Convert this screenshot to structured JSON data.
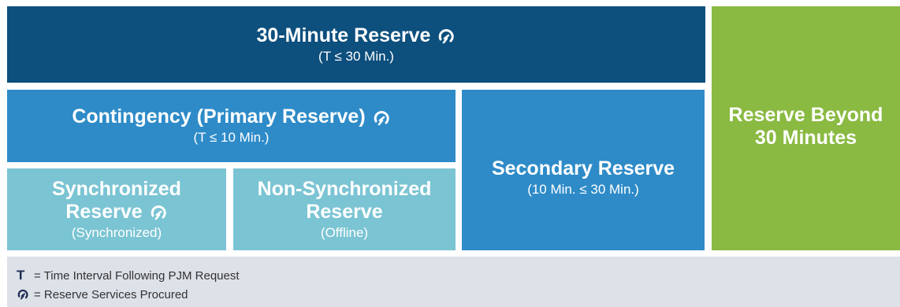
{
  "boxes": {
    "thirty_minute": {
      "title": "30-Minute Reserve",
      "subtitle": "(T ≤ 30 Min.)"
    },
    "contingency": {
      "title": "Contingency (Primary Reserve)",
      "subtitle": "(T ≤ 10 Min.)"
    },
    "synchronized": {
      "title_line1": "Synchronized",
      "title_line2": "Reserve",
      "subtitle": "(Synchronized)"
    },
    "non_synchronized": {
      "title_line1": "Non-Synchronized",
      "title_line2": "Reserve",
      "subtitle": "(Offline)"
    },
    "secondary": {
      "title": "Secondary Reserve",
      "subtitle": "(10 Min. ≤  30 Min.)"
    },
    "beyond": {
      "title_line1": "Reserve Beyond",
      "title_line2": "30 Minutes"
    }
  },
  "legend": {
    "t_symbol": "T",
    "t_text": "= Time Interval Following PJM Request",
    "icon_name": "reserve-procured-icon",
    "icon_text": "= Reserve Services Procured"
  },
  "colors": {
    "dark_blue": "#0d4f7d",
    "mid_blue": "#2e8bc8",
    "light_teal": "#7bc4d3",
    "green": "#8aba42",
    "legend_bg": "#dde1e8"
  }
}
